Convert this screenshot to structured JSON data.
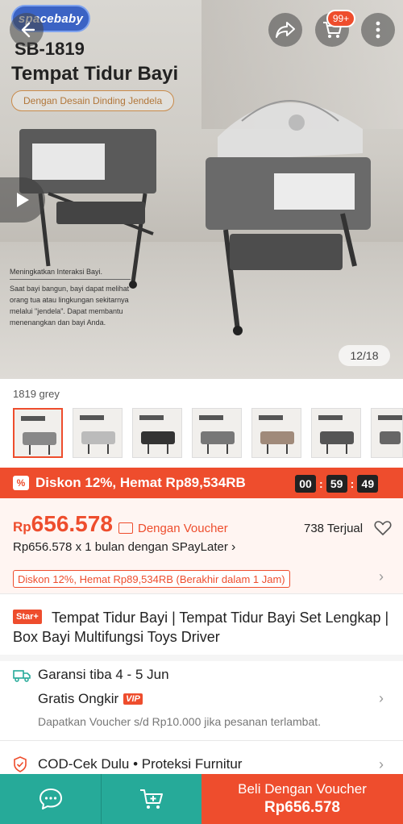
{
  "hero": {
    "brand": "spacebaby",
    "model": "SB-1819",
    "title": "Tempat Tidur Bayi",
    "tagline": "Dengan Desain Dinding Jendela",
    "description_title": "Meningkatkan Interaksi Bayi.",
    "description_body": "Saat bayi bangun, bayi dapat melihat orang tua atau lingkungan sekitarnya melalui \"jendela\". Dapat membantu menenangkan dan bayi Anda.",
    "image_counter": "12/18",
    "cart_badge": "99+"
  },
  "variant": {
    "label": "1819 grey"
  },
  "flash": {
    "text": "Diskon 12%, Hemat Rp89,534RB",
    "timer": [
      "00",
      "59",
      "49"
    ]
  },
  "price": {
    "currency": "Rp",
    "amount": "656.578",
    "voucher_text": "Dengan Voucher",
    "sold": "738 Terjual",
    "spaylater": "Rp656.578 x 1 bulan dengan SPayLater",
    "discount_tag": "Diskon 12%, Hemat Rp89,534RB (Berakhir dalam 1 Jam)"
  },
  "product": {
    "badge": "Star+",
    "name": "Tempat Tidur Bayi | Tempat Tidur Bayi Set Lengkap | Box Bayi Multifungsi Toys Driver"
  },
  "shipping": {
    "guarantee": "Garansi tiba 4 - 5 Jun",
    "free": "Gratis Ongkir",
    "vip": "VIP",
    "voucher_note": "Dapatkan Voucher s/d Rp10.000 jika pesanan terlambat."
  },
  "services": {
    "text": "COD-Cek Dulu  •  Proteksi Furnitur"
  },
  "bottom": {
    "buy_label": "Beli Dengan Voucher",
    "buy_price": "Rp656.578"
  },
  "colors": {
    "accent": "#ee4d2d",
    "teal": "#26aa99"
  }
}
